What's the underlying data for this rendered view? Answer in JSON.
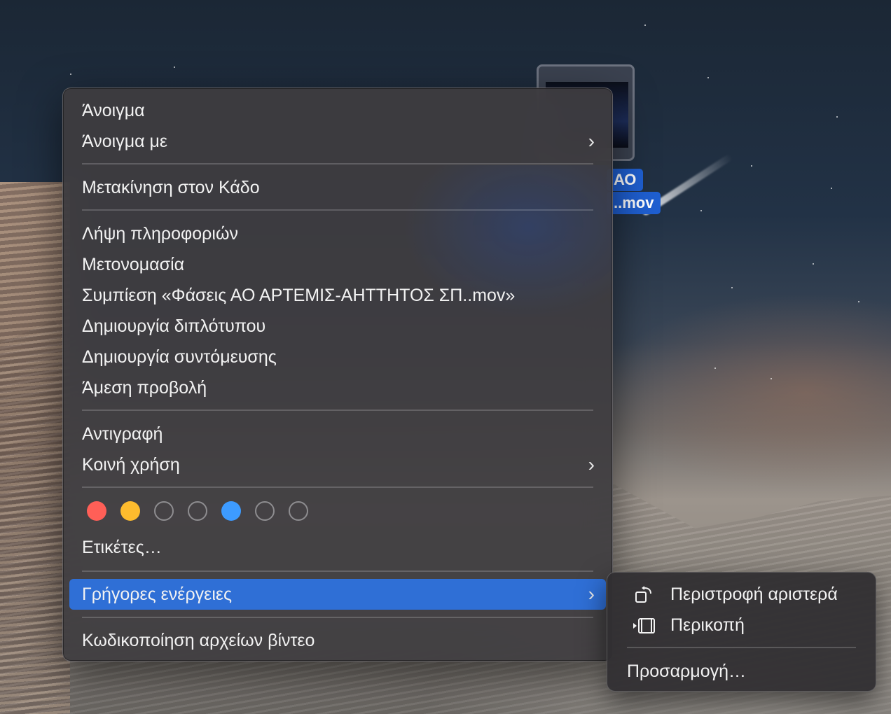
{
  "desktop": {
    "file_label_line1": "ΑΟ",
    "file_label_line2": "..mov"
  },
  "context_menu": {
    "groups": [
      {
        "items": [
          {
            "label": "Άνοιγμα",
            "has_submenu": false
          },
          {
            "label": "Άνοιγμα με",
            "has_submenu": true
          }
        ]
      },
      {
        "items": [
          {
            "label": "Μετακίνηση στον Κάδο",
            "has_submenu": false
          }
        ]
      },
      {
        "items": [
          {
            "label": "Λήψη πληροφοριών",
            "has_submenu": false
          },
          {
            "label": "Μετονομασία",
            "has_submenu": false
          },
          {
            "label": "Συμπίεση «Φάσεις ΑΟ ΑΡΤΕΜΙΣ-ΑΗΤΤΗΤΟΣ ΣΠ..mov»",
            "has_submenu": false
          },
          {
            "label": "Δημιουργία διπλότυπου",
            "has_submenu": false
          },
          {
            "label": "Δημιουργία συντόμευσης",
            "has_submenu": false
          },
          {
            "label": "Άμεση προβολή",
            "has_submenu": false
          }
        ]
      },
      {
        "items": [
          {
            "label": "Αντιγραφή",
            "has_submenu": false
          },
          {
            "label": "Κοινή χρήση",
            "has_submenu": true
          }
        ]
      },
      {
        "items": [
          {
            "label": "Ετικέτες…",
            "has_submenu": false
          }
        ]
      },
      {
        "items": [
          {
            "label": "Γρήγορες ενέργειες",
            "has_submenu": true,
            "highlighted": true
          }
        ]
      },
      {
        "items": [
          {
            "label": "Κωδικοποίηση αρχείων βίντεο",
            "has_submenu": false
          }
        ]
      }
    ],
    "tag_colors": [
      {
        "name": "red",
        "color": "#ff5f57",
        "filled": true
      },
      {
        "name": "orange",
        "color": "#febc2e",
        "filled": true
      },
      {
        "name": "yellow",
        "color": "#8e8d90",
        "filled": false
      },
      {
        "name": "green",
        "color": "#8e8d90",
        "filled": false
      },
      {
        "name": "blue",
        "color": "#3d9bff",
        "filled": true
      },
      {
        "name": "purple",
        "color": "#8e8d90",
        "filled": false
      },
      {
        "name": "gray",
        "color": "#8e8d90",
        "filled": false
      }
    ],
    "chevron": "›",
    "highlight_color": "#2f6fd6"
  },
  "quick_actions_submenu": {
    "items": [
      {
        "label": "Περιστροφή αριστερά",
        "icon": "rotate-left-icon"
      },
      {
        "label": "Περικοπή",
        "icon": "trim-icon"
      }
    ],
    "customize_label": "Προσαρμογή…"
  }
}
